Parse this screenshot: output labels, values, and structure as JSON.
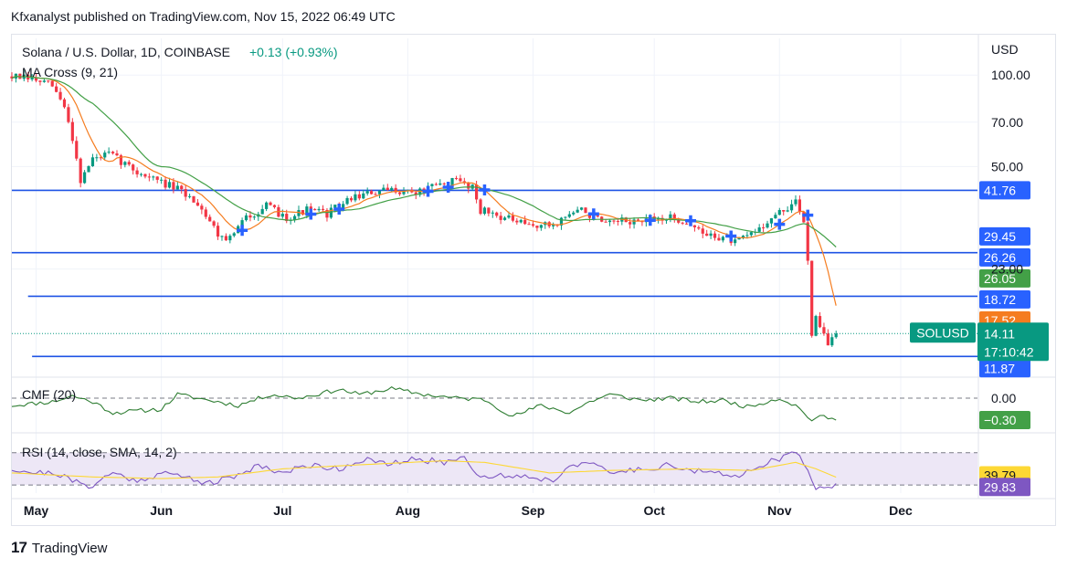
{
  "publisher": "Kfxanalyst published on TradingView.com, Nov 15, 2022 06:49 UTC",
  "brand": {
    "logo": "17",
    "name": "TradingView"
  },
  "header": {
    "symbol": "Solana / U.S. Dollar, 1D, COINBASE",
    "change": "+0.13 (+0.93%)",
    "change_color": "#089981",
    "indicator": "MA Cross (9, 21)",
    "currency": "USD"
  },
  "chart_data": [
    {
      "type": "candlestick",
      "title": "Solana / U.S. Dollar, 1D, COINBASE",
      "y_scale": "log",
      "ylim": [
        10.5,
        115
      ],
      "y_ticks": [
        {
          "value": 100,
          "label": "100.00"
        },
        {
          "value": 70,
          "label": "70.00"
        },
        {
          "value": 50,
          "label": "50.00"
        },
        {
          "value": 23,
          "label": "23.00"
        }
      ],
      "x_range": [
        "2022-04-25",
        "2022-12-20"
      ],
      "month_ticks": [
        {
          "date": "2022-05-01",
          "label": "May"
        },
        {
          "date": "2022-06-01",
          "label": "Jun"
        },
        {
          "date": "2022-07-01",
          "label": "Jul"
        },
        {
          "date": "2022-08-01",
          "label": "Aug"
        },
        {
          "date": "2022-09-01",
          "label": "Sep"
        },
        {
          "date": "2022-10-01",
          "label": "Oct"
        },
        {
          "date": "2022-11-01",
          "label": "Nov"
        },
        {
          "date": "2022-12-01",
          "label": "Dec"
        }
      ],
      "last_date": "2022-11-15",
      "up_color": "#089981",
      "down_color": "#f23645",
      "close_path": [
        [
          "2022-04-25",
          99
        ],
        [
          "2022-05-01",
          96
        ],
        [
          "2022-05-05",
          92
        ],
        [
          "2022-05-08",
          78
        ],
        [
          "2022-05-10",
          62
        ],
        [
          "2022-05-12",
          45
        ],
        [
          "2022-05-15",
          53
        ],
        [
          "2022-05-19",
          55
        ],
        [
          "2022-05-26",
          48
        ],
        [
          "2022-05-31",
          45
        ],
        [
          "2022-06-05",
          42
        ],
        [
          "2022-06-10",
          38
        ],
        [
          "2022-06-15",
          30
        ],
        [
          "2022-06-18",
          29
        ],
        [
          "2022-06-22",
          34
        ],
        [
          "2022-06-27",
          37
        ],
        [
          "2022-07-02",
          34
        ],
        [
          "2022-07-07",
          36
        ],
        [
          "2022-07-12",
          35
        ],
        [
          "2022-07-19",
          40
        ],
        [
          "2022-07-24",
          41
        ],
        [
          "2022-07-29",
          42
        ],
        [
          "2022-08-03",
          41
        ],
        [
          "2022-08-08",
          43
        ],
        [
          "2022-08-13",
          45
        ],
        [
          "2022-08-17",
          43
        ],
        [
          "2022-08-19",
          36
        ],
        [
          "2022-08-25",
          34
        ],
        [
          "2022-08-30",
          32
        ],
        [
          "2022-09-06",
          32
        ],
        [
          "2022-09-10",
          35
        ],
        [
          "2022-09-13",
          36
        ],
        [
          "2022-09-19",
          32
        ],
        [
          "2022-09-23",
          33
        ],
        [
          "2022-09-28",
          33
        ],
        [
          "2022-10-04",
          34
        ],
        [
          "2022-10-09",
          33
        ],
        [
          "2022-10-13",
          30
        ],
        [
          "2022-10-19",
          29
        ],
        [
          "2022-10-21",
          28
        ],
        [
          "2022-10-25",
          30
        ],
        [
          "2022-10-29",
          33
        ],
        [
          "2022-11-05",
          38
        ],
        [
          "2022-11-07",
          33
        ],
        [
          "2022-11-08",
          25
        ],
        [
          "2022-11-09",
          14
        ],
        [
          "2022-11-10",
          16.5
        ],
        [
          "2022-11-11",
          15
        ],
        [
          "2022-11-13",
          13
        ],
        [
          "2022-11-15",
          14.11
        ]
      ],
      "series": [
        {
          "name": "MA 9",
          "color": "#f57c1f",
          "role": "fast MA"
        },
        {
          "name": "MA 21",
          "color": "#43a047",
          "role": "slow MA"
        }
      ],
      "ma_cross_dates": [
        "2022-06-21",
        "2022-07-08",
        "2022-07-15",
        "2022-08-06",
        "2022-08-11",
        "2022-08-20",
        "2022-09-16",
        "2022-09-30",
        "2022-10-10",
        "2022-10-20",
        "2022-11-01",
        "2022-11-08"
      ],
      "ma_cross_color": "#2962ff",
      "horizontal_lines": [
        {
          "value": 41.76,
          "label": "41.76",
          "from_date": "2022-04-25"
        },
        {
          "value": 26.05,
          "label": "26.05",
          "from_date": "2022-04-25"
        },
        {
          "value": 18.72,
          "label": "18.72",
          "from_date": "2022-04-29"
        },
        {
          "value": 11.87,
          "label": "11.87",
          "from_date": "2022-04-30"
        }
      ],
      "line_color": "#1e53e5",
      "price_labels": [
        {
          "value": 41.76,
          "label": "41.76",
          "color": "#2962ff"
        },
        {
          "value": 29.45,
          "label": "29.45",
          "color": "#2962ff"
        },
        {
          "value": 26.26,
          "label": "26.26",
          "color": "#2962ff"
        },
        {
          "value": 26.05,
          "label": "26.05",
          "color": "#43a047"
        },
        {
          "value": 18.72,
          "label": "18.72",
          "color": "#2962ff"
        },
        {
          "value": 17.52,
          "label": "17.52",
          "color": "#f57c1f"
        },
        {
          "value": 11.87,
          "label": "11.87",
          "color": "#2962ff"
        }
      ],
      "last_price": {
        "value": 14.11,
        "label": "14.11",
        "countdown": "17:10:42",
        "symbol": "SOLUSD",
        "color": "#089981"
      }
    },
    {
      "type": "line",
      "title": "CMF (20)",
      "ylim": [
        -0.45,
        0.2
      ],
      "zero_line": 0,
      "y_labels": [
        {
          "value": 0.0,
          "label": "0.00"
        }
      ],
      "value_label": {
        "value": -0.3,
        "label": "−0.30",
        "color": "#43a047"
      },
      "line_color": "#2e7d32",
      "path": [
        [
          "2022-04-25",
          -0.1
        ],
        [
          "2022-05-05",
          -0.05
        ],
        [
          "2022-05-10",
          0.03
        ],
        [
          "2022-05-15",
          -0.05
        ],
        [
          "2022-05-20",
          -0.2
        ],
        [
          "2022-06-01",
          -0.15
        ],
        [
          "2022-06-05",
          0.05
        ],
        [
          "2022-06-10",
          0.0
        ],
        [
          "2022-06-15",
          -0.05
        ],
        [
          "2022-06-20",
          -0.1
        ],
        [
          "2022-06-28",
          0.05
        ],
        [
          "2022-07-05",
          0.0
        ],
        [
          "2022-07-15",
          0.12
        ],
        [
          "2022-07-20",
          0.05
        ],
        [
          "2022-07-28",
          0.13
        ],
        [
          "2022-08-05",
          0.05
        ],
        [
          "2022-08-13",
          0.0
        ],
        [
          "2022-08-20",
          -0.02
        ],
        [
          "2022-08-27",
          -0.25
        ],
        [
          "2022-09-03",
          -0.1
        ],
        [
          "2022-09-10",
          -0.2
        ],
        [
          "2022-09-15",
          -0.05
        ],
        [
          "2022-09-20",
          0.05
        ],
        [
          "2022-09-28",
          -0.03
        ],
        [
          "2022-10-05",
          0.0
        ],
        [
          "2022-10-12",
          -0.05
        ],
        [
          "2022-10-18",
          -0.03
        ],
        [
          "2022-10-24",
          -0.12
        ],
        [
          "2022-11-01",
          0.0
        ],
        [
          "2022-11-05",
          -0.1
        ],
        [
          "2022-11-09",
          -0.3
        ],
        [
          "2022-11-12",
          -0.25
        ],
        [
          "2022-11-15",
          -0.3
        ]
      ]
    },
    {
      "type": "line",
      "title": "RSI (14, close, SMA, 14, 2)",
      "ylim": [
        20,
        90
      ],
      "band": [
        30,
        70
      ],
      "band_color": "#ede7f6",
      "series": [
        {
          "role": "RSI",
          "color": "#7e57c2",
          "path": [
            [
              "2022-04-25",
              50
            ],
            [
              "2022-05-01",
              45
            ],
            [
              "2022-05-06",
              45
            ],
            [
              "2022-05-10",
              35
            ],
            [
              "2022-05-14",
              28
            ],
            [
              "2022-05-20",
              45
            ],
            [
              "2022-05-26",
              35
            ],
            [
              "2022-06-01",
              45
            ],
            [
              "2022-06-07",
              40
            ],
            [
              "2022-06-13",
              32
            ],
            [
              "2022-06-19",
              40
            ],
            [
              "2022-06-25",
              55
            ],
            [
              "2022-07-01",
              45
            ],
            [
              "2022-07-08",
              55
            ],
            [
              "2022-07-15",
              50
            ],
            [
              "2022-07-21",
              62
            ],
            [
              "2022-07-27",
              55
            ],
            [
              "2022-08-03",
              62
            ],
            [
              "2022-08-10",
              58
            ],
            [
              "2022-08-15",
              65
            ],
            [
              "2022-08-19",
              40
            ],
            [
              "2022-08-26",
              42
            ],
            [
              "2022-09-01",
              40
            ],
            [
              "2022-09-06",
              35
            ],
            [
              "2022-09-10",
              55
            ],
            [
              "2022-09-14",
              58
            ],
            [
              "2022-09-20",
              45
            ],
            [
              "2022-09-28",
              50
            ],
            [
              "2022-10-05",
              55
            ],
            [
              "2022-10-10",
              48
            ],
            [
              "2022-10-15",
              45
            ],
            [
              "2022-10-21",
              40
            ],
            [
              "2022-10-27",
              55
            ],
            [
              "2022-11-02",
              64
            ],
            [
              "2022-11-05",
              70
            ],
            [
              "2022-11-08",
              50
            ],
            [
              "2022-11-10",
              28
            ],
            [
              "2022-11-13",
              28
            ],
            [
              "2022-11-15",
              29.83
            ]
          ]
        },
        {
          "role": "SMA",
          "color": "#fdd835",
          "path": [
            [
              "2022-04-25",
              45
            ],
            [
              "2022-05-15",
              40
            ],
            [
              "2022-06-01",
              38
            ],
            [
              "2022-06-15",
              40
            ],
            [
              "2022-07-01",
              50
            ],
            [
              "2022-07-20",
              55
            ],
            [
              "2022-08-10",
              60
            ],
            [
              "2022-08-20",
              58
            ],
            [
              "2022-09-05",
              45
            ],
            [
              "2022-09-20",
              48
            ],
            [
              "2022-10-10",
              50
            ],
            [
              "2022-10-25",
              48
            ],
            [
              "2022-11-05",
              58
            ],
            [
              "2022-11-10",
              50
            ],
            [
              "2022-11-15",
              39.79
            ]
          ]
        }
      ],
      "value_labels": [
        {
          "value": 39.79,
          "label": "39.79",
          "color": "#fdd835",
          "text_color": "#131722"
        },
        {
          "value": 29.83,
          "label": "29.83",
          "color": "#7e57c2",
          "text_color": "#ffffff"
        }
      ]
    }
  ]
}
